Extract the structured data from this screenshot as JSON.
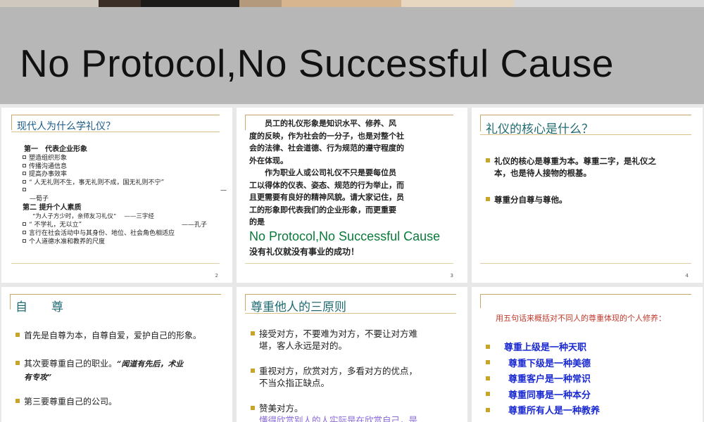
{
  "banner": {
    "title": "No Protocol,No Successful Cause"
  },
  "slide2": {
    "title": "现代人为什么学礼仪？",
    "section1": "第一　代表企业形象",
    "items1": [
      "塑造组织形象",
      "传播沟通信息",
      "提高办事效率",
      "“ 人无礼则不生，事无礼则不成，国无礼则不宁”",
      ""
    ],
    "dash": "—",
    "xunzi": "—荀子",
    "section2": "第二  提升个人素质",
    "quote1": "“为人子方少时，亲师友习礼仪”　  ——三字经",
    "quote2": "“ 不学礼，无以立”",
    "confucius": "——孔子",
    "items2": [
      "言行在社会活动中与其身份、地位、社会角色相适应",
      "个人道德水准和教养的尺度"
    ],
    "page": "2"
  },
  "slide3": {
    "lines": [
      "　　员工的礼仪形象是知识水平、修养、风",
      "度的反映，作为社会的一分子，也是对整个社",
      "会的法律、社会道德、行为规范的遵守程度的",
      "外在体现。",
      "　　作为职业人或公司礼仪不只是要每位员",
      "工以得体的仪表、姿态、规范的行为举止，而",
      "且更需要有良好的精神风貌。请大家记住，员",
      "工的形象即代表我们的企业形象，而更重要",
      "的是"
    ],
    "english": "No Protocol,No Successful Cause",
    "tagline": "没有礼仪就没有事业的成功！",
    "page": "3"
  },
  "slide4": {
    "title": "礼仪的核心是什么？",
    "b1_line1": "礼仪的核心是尊重为本。尊重二字，是礼仪之",
    "b1_line2": "本，也是待人接物的根基。",
    "b2": "尊重分自尊与尊他。",
    "page": "4"
  },
  "slide5": {
    "title": "自　　尊",
    "b1": "首先是自尊为本，自尊自爱，爱护自己的形象。",
    "b2_line1": "其次要尊重自己的职业。",
    "b2_quote1": "“闻道有先后，术业",
    "b2_quote2": "有专攻”",
    "b3": "第三要尊重自己的公司。"
  },
  "slide6": {
    "title": "尊重他人的三原则",
    "b1_line1": "接受对方，不要难为对方，不要让对方难",
    "b1_line2": "堪，客人永远是对的。",
    "b2_line1": "重视对方，欣赏对方，多看对方的优点，",
    "b2_line2": "不当众指正缺点。",
    "b3": "赞美对方。",
    "b3_sub": "懂得欣赏别人的人实际是在欣赏自己，是"
  },
  "slide7": {
    "intro": "用五句话来概括对不同人的尊重体现的个人修养：",
    "items": [
      "尊重上级是一种天职",
      "尊重下级是一种美德",
      "尊重客户是一种常识",
      "尊重同事是一种本分",
      "尊重所有人是一种教养"
    ]
  },
  "colors": {
    "title_teal": "#1f6b73",
    "bullet_gold": "#c9a42a",
    "green_english": "#0a7a3a",
    "blue_items": "#1a2ad0",
    "intro_red": "#c0392b",
    "sub_purple": "#8a6bd8"
  }
}
